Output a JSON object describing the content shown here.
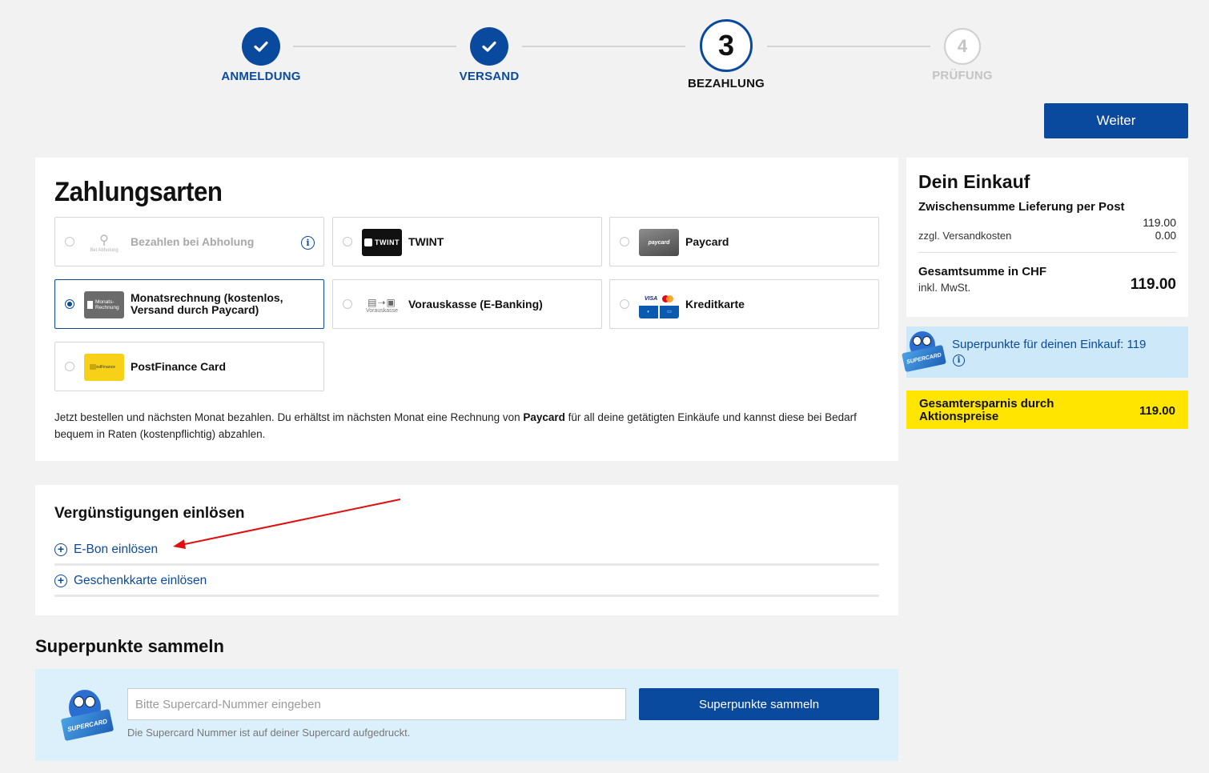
{
  "stepper": {
    "steps": [
      {
        "label": "ANMELDUNG",
        "state": "done"
      },
      {
        "label": "VERSAND",
        "state": "done"
      },
      {
        "label": "BEZAHLUNG",
        "state": "active",
        "number": "3"
      },
      {
        "label": "PRÜFUNG",
        "state": "todo",
        "number": "4"
      }
    ]
  },
  "header": {
    "next_button": "Weiter"
  },
  "payment": {
    "title": "Zahlungsarten",
    "options": [
      {
        "label": "Bezahlen bei Abholung",
        "logo_text": "Bei Abholung",
        "state": "disabled"
      },
      {
        "label": "TWINT",
        "logo_text": "TWINT",
        "state": "available"
      },
      {
        "label": "Paycard",
        "logo_text": "paycard",
        "state": "available"
      },
      {
        "label": "Monatsrechnung (kostenlos, Versand durch Paycard)",
        "logo_text": "Monats-Rechnung",
        "state": "selected"
      },
      {
        "label": "Vorauskasse (E-Banking)",
        "logo_text": "Vorauskasse",
        "state": "available"
      },
      {
        "label": "Kreditkarte",
        "logo_text": "VISA",
        "state": "available"
      },
      {
        "label": "PostFinance Card",
        "logo_text": "PostFinance",
        "state": "available"
      }
    ],
    "description_before": "Jetzt bestellen und nächsten Monat bezahlen. Du erhältst im nächsten Monat eine Rechnung von ",
    "description_bold": "Paycard",
    "description_after": " für all deine getätigten Einkäufe und kannst diese bei Bedarf bequem in Raten (kostenpflichtig) abzahlen."
  },
  "discounts": {
    "title": "Vergünstigungen einlösen",
    "items": [
      {
        "label": "E-Bon einlösen"
      },
      {
        "label": "Geschenkkarte einlösen"
      }
    ]
  },
  "superpoints_collect": {
    "title": "Superpunkte sammeln",
    "input_placeholder": "Bitte Supercard-Nummer eingeben",
    "input_value": "",
    "hint": "Die Supercard Nummer ist auf deiner Supercard aufgedruckt.",
    "button": "Superpunkte sammeln",
    "card_text": "SUPERCARD"
  },
  "cart": {
    "title": "Dein Einkauf",
    "subtotal_label": "Zwischensumme Lieferung per Post",
    "subtotal_value": "119.00",
    "shipping_label": "zzgl. Versandkosten",
    "shipping_value": "0.00",
    "total_label": "Gesamtsumme in CHF",
    "total_sub": "inkl. MwSt.",
    "total_value": "119.00"
  },
  "superpoints_info": {
    "text": "Superpunkte für deinen Einkauf: 119"
  },
  "savings": {
    "label": "Gesamtersparnis durch Aktionspreise",
    "value": "119.00"
  },
  "colors": {
    "primary": "#0a4a9e",
    "page_bg": "#f2f2f2",
    "savings_bg": "#ffe500",
    "superpoints_bg": "#dcf0fb",
    "annotation_arrow": "#e01010"
  }
}
